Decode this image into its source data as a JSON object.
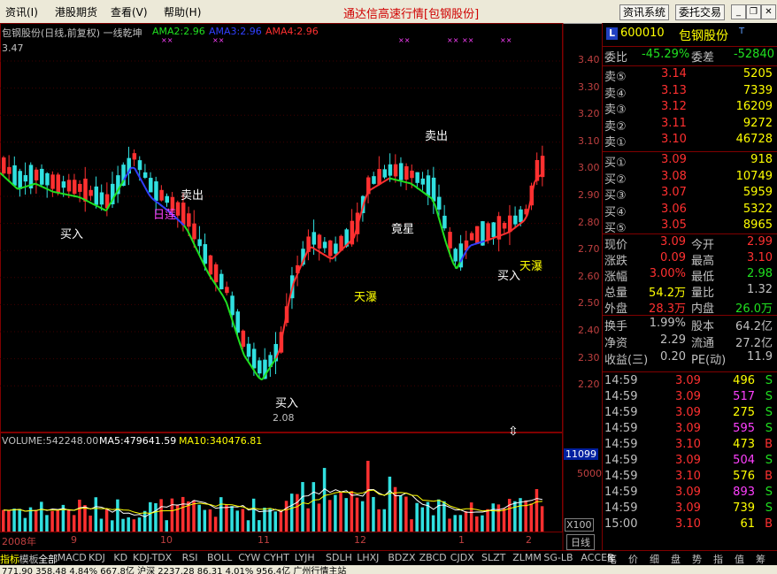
{
  "menu": {
    "items": [
      "资讯(I)",
      "港股期货",
      "查看(V)",
      "帮助(H)"
    ],
    "title": "通达信高速行情[包钢股份]",
    "btn_info": "资讯系统",
    "btn_trade": "委托交易"
  },
  "chart": {
    "header": "包钢股份(日线,前复权) 一线乾坤",
    "ama2": "AMA2:2.96",
    "ama3": "AMA3:2.96",
    "ama4": "AMA4:2.96",
    "high_label": "3.47",
    "low_label": "2.08",
    "y_ticks": [
      "3.40",
      "3.30",
      "3.20",
      "3.10",
      "3.00",
      "2.90",
      "2.80",
      "2.70",
      "2.60",
      "2.50",
      "2.40",
      "2.30",
      "2.20"
    ],
    "annotations": {
      "buy1": "买入",
      "buy2": "买入",
      "buy3": "买入",
      "sell1": "卖出",
      "sell2": "卖出",
      "rilian": "日莲",
      "tianpu1": "天瀑",
      "tianpu2": "天瀑",
      "jingxing": "竟星"
    },
    "volume_header": "VOLUME:542248.00",
    "ma5": "MA5:479641.59",
    "ma10": "MA10:340476.81",
    "vol_box": "11099",
    "vol_tick": "5000",
    "vol_unit": "X100",
    "x_labels": [
      "2008年",
      "9",
      "10",
      "11",
      "12",
      "1",
      "2"
    ],
    "rixian": "日线"
  },
  "colors": {
    "up": "#ff3030",
    "down": "#30e0e0",
    "ma_yellow": "#ffff00",
    "ma_white": "#ffffff",
    "ama_green": "#20e020",
    "ama_red": "#ff3030",
    "ama_blue": "#3040ff"
  },
  "quote": {
    "code": "600010",
    "name": "包钢股份",
    "weibi_label": "委比",
    "weibi": "-45.29%",
    "weicha_label": "委差",
    "weicha": "-52840",
    "asks": [
      {
        "label": "卖⑤",
        "price": "3.14",
        "vol": "5205"
      },
      {
        "label": "卖④",
        "price": "3.13",
        "vol": "7339"
      },
      {
        "label": "卖③",
        "price": "3.12",
        "vol": "16209"
      },
      {
        "label": "卖②",
        "price": "3.11",
        "vol": "9272"
      },
      {
        "label": "卖①",
        "price": "3.10",
        "vol": "46728"
      }
    ],
    "bids": [
      {
        "label": "买①",
        "price": "3.09",
        "vol": "918"
      },
      {
        "label": "买②",
        "price": "3.08",
        "vol": "10749"
      },
      {
        "label": "买③",
        "price": "3.07",
        "vol": "5959"
      },
      {
        "label": "买④",
        "price": "3.06",
        "vol": "5322"
      },
      {
        "label": "买⑤",
        "price": "3.05",
        "vol": "8965"
      }
    ],
    "stats": [
      {
        "l1": "现价",
        "v1": "3.09",
        "l2": "今开",
        "v2": "2.99"
      },
      {
        "l1": "涨跌",
        "v1": "0.09",
        "l2": "最高",
        "v2": "3.10"
      },
      {
        "l1": "涨幅",
        "v1": "3.00%",
        "l2": "最低",
        "v2": "2.98"
      },
      {
        "l1": "总量",
        "v1": "54.2万",
        "l2": "量比",
        "v2": "1.32"
      },
      {
        "l1": "外盘",
        "v1": "28.3万",
        "l2": "内盘",
        "v2": "26.0万"
      }
    ],
    "stats2": [
      {
        "l1": "换手",
        "v1": "1.99%",
        "l2": "股本",
        "v2": "64.2亿"
      },
      {
        "l1": "净资",
        "v1": "2.29",
        "l2": "流通",
        "v2": "27.2亿"
      },
      {
        "l1": "收益(三)",
        "v1": "0.20",
        "l2": "PE(动)",
        "v2": "11.9"
      }
    ],
    "ticks": [
      {
        "t": "14:59",
        "p": "3.09",
        "v": "496",
        "d": "S"
      },
      {
        "t": "14:59",
        "p": "3.09",
        "v": "517",
        "d": "S"
      },
      {
        "t": "14:59",
        "p": "3.09",
        "v": "275",
        "d": "S"
      },
      {
        "t": "14:59",
        "p": "3.09",
        "v": "595",
        "d": "S"
      },
      {
        "t": "14:59",
        "p": "3.10",
        "v": "473",
        "d": "B"
      },
      {
        "t": "14:59",
        "p": "3.09",
        "v": "504",
        "d": "S"
      },
      {
        "t": "14:59",
        "p": "3.10",
        "v": "576",
        "d": "B"
      },
      {
        "t": "14:59",
        "p": "3.09",
        "v": "893",
        "d": "S"
      },
      {
        "t": "14:59",
        "p": "3.09",
        "v": "739",
        "d": "S"
      },
      {
        "t": "15:00",
        "p": "3.10",
        "v": "61",
        "d": "B"
      }
    ]
  },
  "tabs": {
    "left": [
      "指标",
      "模板",
      "全部",
      "MACD",
      "KDJ",
      "KD",
      "KDJ-TDX",
      "RSI",
      "BOLL",
      "CYW",
      "CYHT",
      "LYJH",
      "SDLH",
      "LHXJ",
      "BDZX",
      "ZBCD",
      "CJDX",
      "SLZT",
      "ZLMM",
      "SG-LB",
      "ACCER"
    ],
    "right": [
      "笔",
      "价",
      "细",
      "盘",
      "势",
      "指",
      "值",
      "筹"
    ]
  },
  "status": "771.90 358.48 4.84% 667.8亿 沪深 2237.28 86.31 4.01% 956.4亿 广州行情主站"
}
